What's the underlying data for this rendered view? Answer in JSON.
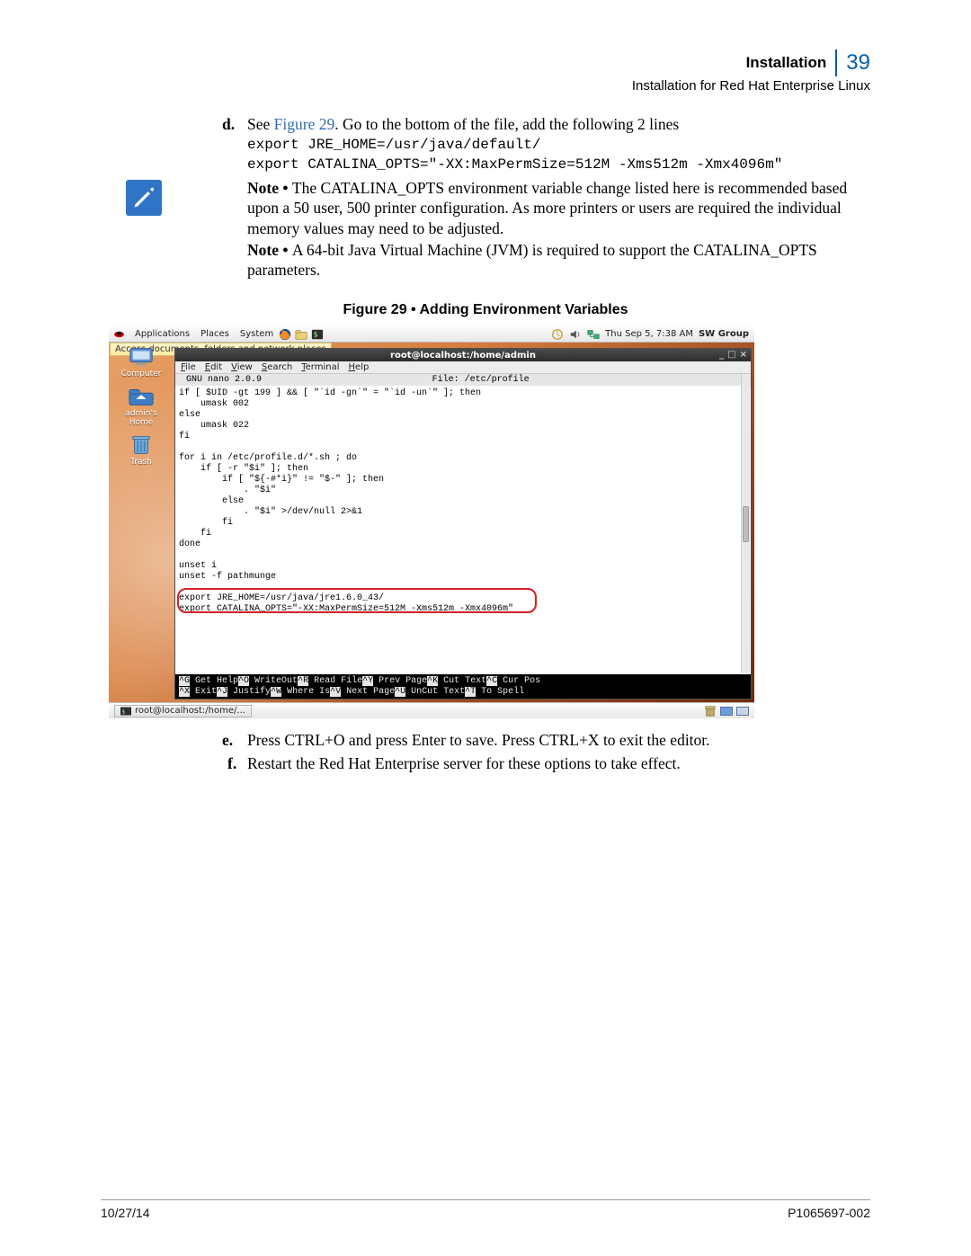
{
  "header": {
    "title": "Installation",
    "page_no": "39",
    "subtitle": "Installation for Red Hat Enterprise Linux"
  },
  "step_d": {
    "letter": "d.",
    "pre": "See ",
    "link": "Figure 29",
    "post": ". Go to the bottom of the file, add the following 2 lines",
    "code_l1": "export JRE_HOME=/usr/java/default/",
    "code_l2": "export CATALINA_OPTS=\"-XX:MaxPermSize=512M -Xms512m -Xmx4096m\""
  },
  "note1": {
    "label": "Note • ",
    "text": "The CATALINA_OPTS environment variable change listed here is recommended based upon a 50 user, 500 printer configuration. As more printers or users are required the individual memory values may need to be adjusted."
  },
  "note2": {
    "label": "Note • ",
    "text": "A 64-bit Java Virtual Machine (JVM) is required to support the CATALINA_OPTS parameters."
  },
  "figure_caption": "Figure 29 • Adding Environment Variables",
  "shot": {
    "topbar": {
      "menus": [
        "Applications",
        "Places",
        "System"
      ],
      "clock": "Thu Sep  5,  7:38 AM",
      "user": "SW Group"
    },
    "tooltip": "Access documents, folders and network places",
    "desktop_icons": [
      {
        "label": "Computer"
      },
      {
        "label": "admin's Home"
      },
      {
        "label": "Trash"
      }
    ],
    "terminal": {
      "title": "root@localhost:/home/admin",
      "menu": [
        "File",
        "Edit",
        "View",
        "Search",
        "Terminal",
        "Help"
      ],
      "nano_version": "  GNU nano 2.0.9",
      "nano_file": "File: /etc/profile",
      "body": "if [ $UID -gt 199 ] && [ \"`id -gn`\" = \"`id -un`\" ]; then\n    umask 002\nelse\n    umask 022\nfi\n\nfor i in /etc/profile.d/*.sh ; do\n    if [ -r \"$i\" ]; then\n        if [ \"${-#*i}\" != \"$-\" ]; then\n            . \"$i\"\n        else\n            . \"$i\" >/dev/null 2>&1\n        fi\n    fi\ndone\n\nunset i\nunset -f pathmunge\n\nexport JRE_HOME=/usr/java/jre1.6.0_43/\nexport CATALINA_OPTS=\"-XX:MaxPermSize=512M -Xms512m -Xmx4096m\"",
      "shortcuts_row1": [
        [
          "^G",
          "Get Help"
        ],
        [
          "^O",
          "WriteOut"
        ],
        [
          "^R",
          "Read File"
        ],
        [
          "^Y",
          "Prev Page"
        ],
        [
          "^K",
          "Cut Text"
        ],
        [
          "^C",
          "Cur Pos"
        ]
      ],
      "shortcuts_row2": [
        [
          "^X",
          "Exit"
        ],
        [
          "^J",
          "Justify"
        ],
        [
          "^W",
          "Where Is"
        ],
        [
          "^V",
          "Next Page"
        ],
        [
          "^U",
          "UnCut Text"
        ],
        [
          "^T",
          "To Spell"
        ]
      ]
    },
    "taskbar": {
      "btn": "root@localhost:/home/..."
    }
  },
  "step_e": {
    "letter": "e.",
    "text": "Press CTRL+O and press Enter to save. Press CTRL+X to exit the editor."
  },
  "step_f": {
    "letter": "f.",
    "text": "Restart the Red Hat Enterprise server for these options to take effect."
  },
  "footer": {
    "left": "10/27/14",
    "right": "P1065697-002"
  }
}
